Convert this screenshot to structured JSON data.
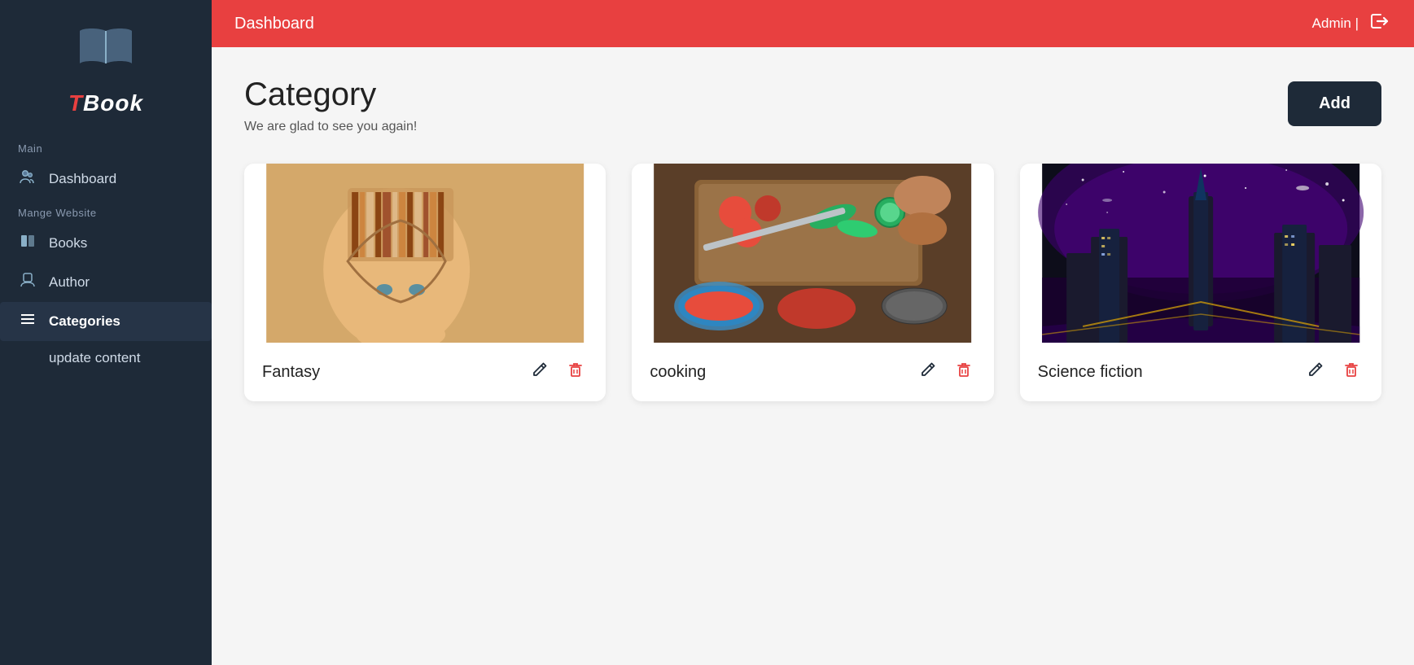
{
  "sidebar": {
    "logo_icon": "📖",
    "brand_t": "T",
    "brand_book": "Book",
    "section_main": "Main",
    "section_manage": "Mange Website",
    "items": [
      {
        "id": "dashboard",
        "label": "Dashboard",
        "icon": "👥",
        "active": false
      },
      {
        "id": "books",
        "label": "Books",
        "icon": "📖",
        "active": false
      },
      {
        "id": "author",
        "label": "Author",
        "icon": "👤",
        "active": false
      },
      {
        "id": "categories",
        "label": "Categories",
        "icon": "☰",
        "active": true
      },
      {
        "id": "update-content",
        "label": "update content",
        "icon": "",
        "active": false
      }
    ]
  },
  "header": {
    "title": "Dashboard",
    "user": "Admin |",
    "logout_label": "logout"
  },
  "page": {
    "title": "Category",
    "subtitle": "We are glad to see you again!",
    "add_button_label": "Add"
  },
  "categories": [
    {
      "id": "fantasy",
      "label": "Fantasy",
      "color1": "#c8a46e",
      "color2": "#7a5c3a"
    },
    {
      "id": "cooking",
      "label": "cooking",
      "color1": "#c0392b",
      "color2": "#27ae60"
    },
    {
      "id": "science-fiction",
      "label": "Science fiction",
      "color1": "#6a0dad",
      "color2": "#1a1a2e"
    }
  ]
}
